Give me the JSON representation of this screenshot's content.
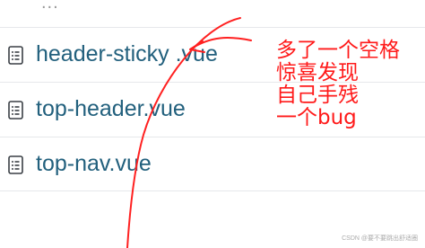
{
  "top_fragment": "...",
  "files": [
    {
      "name": "header-sticky .vue",
      "icon": "document-list-icon"
    },
    {
      "name": "top-header.vue",
      "icon": "document-list-icon"
    },
    {
      "name": "top-nav.vue",
      "icon": "document-list-icon"
    }
  ],
  "annotation": {
    "lines": [
      "多了一个空格",
      "惊喜发现",
      "自己手残",
      "一个bug"
    ],
    "color": "#ff1a1a"
  },
  "watermark": "CSDN @要不要跳出舒适圈"
}
